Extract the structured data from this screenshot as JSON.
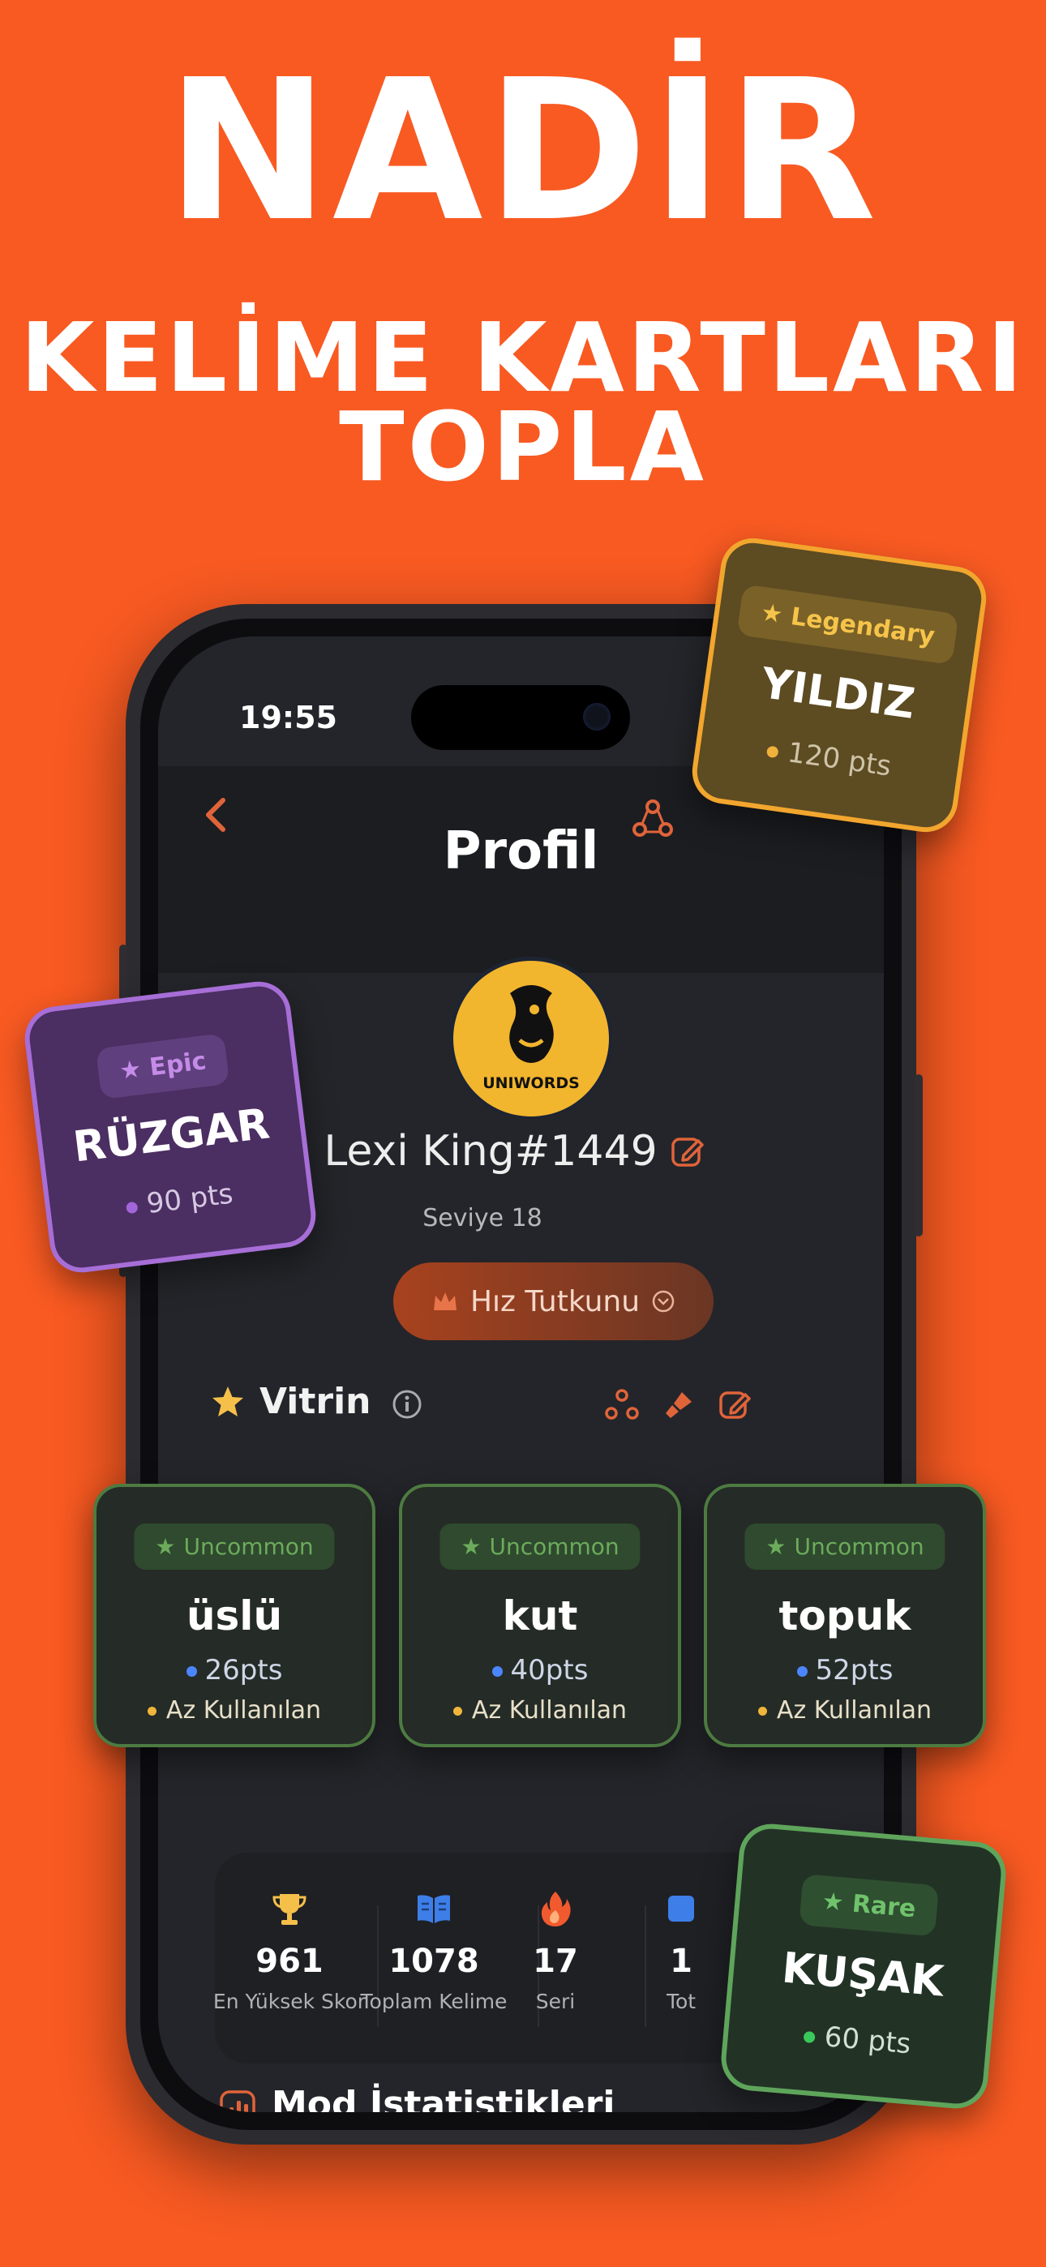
{
  "headline": {
    "line1": "NADİR",
    "line2": "KELİME KARTLARI",
    "line3": "TOPLA"
  },
  "status_bar": {
    "time": "19:55"
  },
  "header": {
    "title": "Profil"
  },
  "profile": {
    "avatar_text": "UNIWORDS",
    "username": "Lexi King#1449",
    "level": "Seviye 18",
    "title_badge": "Hız Tutkunu"
  },
  "vitrin": {
    "label": "Vitrin",
    "cards": [
      {
        "rarity": "Uncommon",
        "word": "üslü",
        "points": "26pts",
        "frequency": "Az Kullanılan"
      },
      {
        "rarity": "Uncommon",
        "word": "kut",
        "points": "40pts",
        "frequency": "Az Kullanılan"
      },
      {
        "rarity": "Uncommon",
        "word": "topuk",
        "points": "52pts",
        "frequency": "Az Kullanılan"
      }
    ]
  },
  "stats": [
    {
      "icon": "trophy-icon",
      "value": "961",
      "label": "En Yüksek Skor"
    },
    {
      "icon": "book-icon",
      "value": "1078",
      "label": "Toplam Kelime"
    },
    {
      "icon": "fire-icon",
      "value": "17",
      "label": "Seri"
    },
    {
      "icon": "stat-icon",
      "value": "1",
      "label": "Tot"
    }
  ],
  "mode_stats": {
    "title": "Mod İstatistikleri"
  },
  "floating_cards": {
    "legendary": {
      "rarity": "Legendary",
      "word": "YILDIZ",
      "points": "120 pts"
    },
    "epic": {
      "rarity": "Epic",
      "word": "RÜZGAR",
      "points": "90 pts"
    },
    "rare": {
      "rarity": "Rare",
      "word": "KUŞAK",
      "points": "60 pts"
    }
  },
  "colors": {
    "background": "#F85A22",
    "screen": "#24252a",
    "accent_orange": "#e0643a",
    "uncommon_green": "#6cab5c",
    "legendary_gold": "#f2a62e",
    "epic_purple": "#a66ed6",
    "rare_green": "#5ea55b"
  }
}
